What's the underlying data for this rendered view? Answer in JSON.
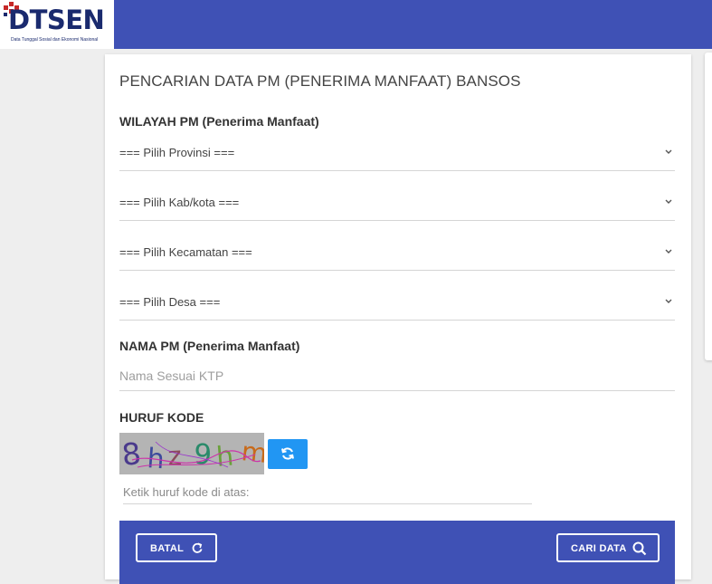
{
  "header": {
    "logo_text": "DTSEN",
    "logo_subtitle": "Data Tunggal Sosial dan Ekonomi Nasional"
  },
  "form": {
    "title": "PENCARIAN DATA PM (PENERIMA MANFAAT) BANSOS",
    "wilayah_label": "WILAYAH PM (Penerima Manfaat)",
    "provinsi": "=== Pilih Provinsi ===",
    "kabkota": "=== Pilih Kab/kota ===",
    "kecamatan": "=== Pilih Kecamatan ===",
    "desa": "=== Pilih Desa ===",
    "nama_label": "NAMA PM (Penerima Manfaat)",
    "nama_placeholder": "Nama Sesuai KTP",
    "kode_label": "HURUF KODE",
    "captcha_text": "8hz9hm",
    "captcha_placeholder": "Ketik huruf kode di atas:",
    "batal_label": "BATAL",
    "cari_label": "CARI DATA"
  },
  "colors": {
    "primary": "#3f51b5",
    "refresh": "#2196f3"
  },
  "icons": [
    "chevron-down-icon",
    "refresh-icon",
    "search-icon"
  ]
}
